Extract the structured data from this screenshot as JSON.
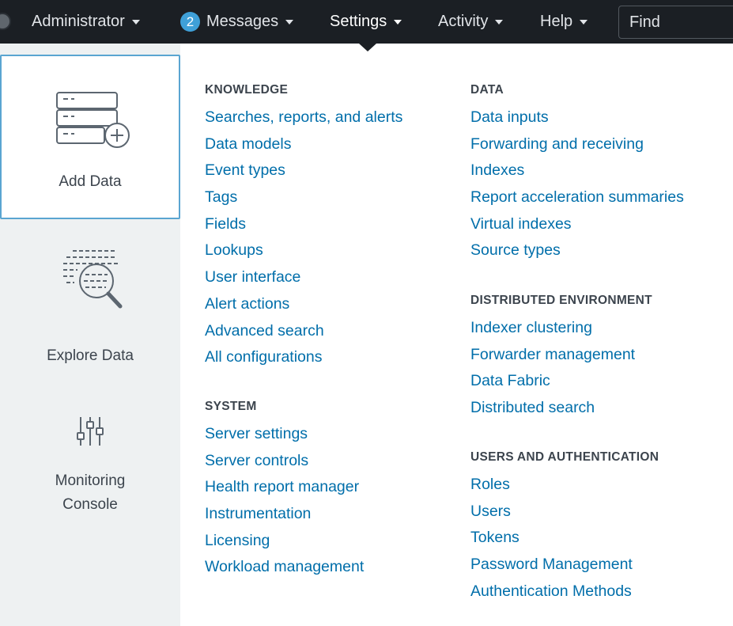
{
  "topbar": {
    "items": [
      {
        "label": "Administrator"
      },
      {
        "label": "Messages",
        "badge": "2"
      },
      {
        "label": "Settings"
      },
      {
        "label": "Activity"
      },
      {
        "label": "Help"
      }
    ],
    "find_placeholder": "Find"
  },
  "rail": {
    "tiles": [
      {
        "label": "Add Data",
        "icon": "database-add-icon",
        "selected": true
      },
      {
        "label": "Explore Data",
        "icon": "search-data-icon"
      },
      {
        "label_line1": "Monitoring",
        "label_line2": "Console",
        "icon": "sliders-icon"
      }
    ]
  },
  "knowledge": {
    "heading": "KNOWLEDGE",
    "links": [
      "Searches, reports, and alerts",
      "Data models",
      "Event types",
      "Tags",
      "Fields",
      "Lookups",
      "User interface",
      "Alert actions",
      "Advanced search",
      "All configurations"
    ]
  },
  "system": {
    "heading": "SYSTEM",
    "links": [
      "Server settings",
      "Server controls",
      "Health report manager",
      "Instrumentation",
      "Licensing",
      "Workload management"
    ]
  },
  "data_section": {
    "heading": "DATA",
    "links": [
      "Data inputs",
      "Forwarding and receiving",
      "Indexes",
      "Report acceleration summaries",
      "Virtual indexes",
      "Source types"
    ]
  },
  "distributed": {
    "heading": "DISTRIBUTED ENVIRONMENT",
    "links": [
      "Indexer clustering",
      "Forwarder management",
      "Data Fabric",
      "Distributed search"
    ]
  },
  "users_auth": {
    "heading": "USERS AND AUTHENTICATION",
    "links": [
      "Roles",
      "Users",
      "Tokens",
      "Password Management",
      "Authentication Methods"
    ]
  },
  "colors": {
    "topbar": "#1b1f24",
    "link": "#006eaa",
    "badge": "#3fa0d8",
    "rail": "#eef1f2",
    "selected_border": "#5aa5d1"
  }
}
